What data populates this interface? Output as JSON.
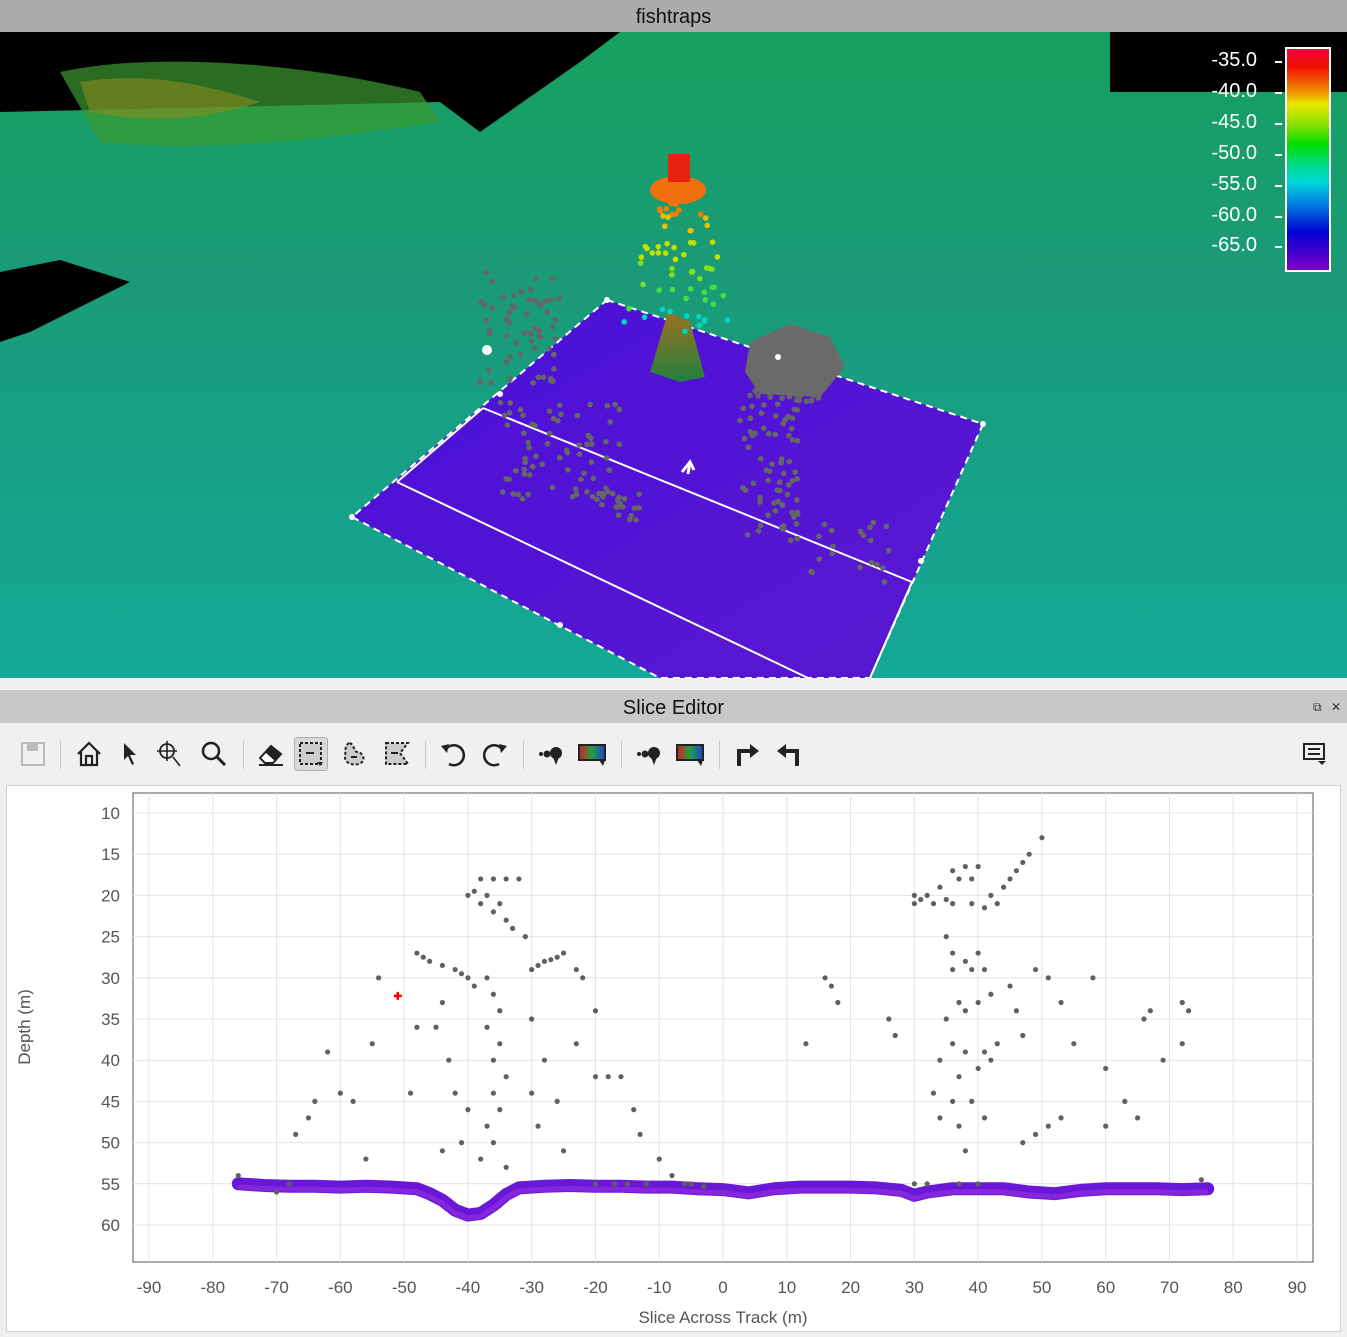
{
  "window_title": "fishtraps",
  "colorbar": {
    "labels": [
      "-35.0",
      "-40.0",
      "-45.0",
      "-50.0",
      "-55.0",
      "-60.0",
      "-65.0"
    ],
    "range": [
      -68,
      -33
    ]
  },
  "slice_editor": {
    "title": "Slice Editor",
    "float_icon": "⧉",
    "close_icon": "✕",
    "toolbar": [
      {
        "name": "save",
        "icon": "save-icon",
        "enabled": false
      },
      {
        "name": "home",
        "icon": "home-icon"
      },
      {
        "name": "select",
        "icon": "pointer-icon"
      },
      {
        "name": "pick",
        "icon": "crosshair-icon"
      },
      {
        "name": "zoom",
        "icon": "magnifier-icon"
      },
      {
        "name": "erase",
        "icon": "eraser-icon"
      },
      {
        "name": "rect-select",
        "icon": "rect-select-icon",
        "active": true
      },
      {
        "name": "lasso-select",
        "icon": "lasso-icon"
      },
      {
        "name": "poly-select",
        "icon": "poly-select-icon"
      },
      {
        "name": "undo",
        "icon": "undo-icon"
      },
      {
        "name": "redo",
        "icon": "redo-icon"
      },
      {
        "name": "point-style",
        "icon": "points-icon"
      },
      {
        "name": "color-map",
        "icon": "colormap-icon"
      },
      {
        "name": "point-style-2",
        "icon": "points-icon"
      },
      {
        "name": "color-map-2",
        "icon": "colormap-icon"
      },
      {
        "name": "next-slice",
        "icon": "turn-right-icon"
      },
      {
        "name": "prev-slice",
        "icon": "turn-left-icon"
      },
      {
        "name": "menu",
        "icon": "menu-icon"
      }
    ]
  },
  "chart_data": {
    "type": "scatter",
    "xlabel": "Slice Across Track (m)",
    "ylabel": "Depth (m)",
    "xlim": [
      -92.5,
      92.5
    ],
    "ylim": [
      7.6,
      64.6
    ],
    "y_inverted": true,
    "grid": true,
    "xticks": [
      "-90",
      "-80",
      "-70",
      "-60",
      "-50",
      "-40",
      "-30",
      "-20",
      "-10",
      "0",
      "10",
      "20",
      "30",
      "40",
      "50",
      "60",
      "70",
      "80",
      "90"
    ],
    "xtick_values": [
      -90,
      -80,
      -70,
      -60,
      -50,
      -40,
      -30,
      -20,
      -10,
      0,
      10,
      20,
      30,
      40,
      50,
      60,
      70,
      80,
      90
    ],
    "yticks": [
      "10",
      "15",
      "20",
      "25",
      "30",
      "35",
      "40",
      "45",
      "50",
      "55",
      "60"
    ],
    "ytick_values": [
      10,
      15,
      20,
      25,
      30,
      35,
      40,
      45,
      50,
      55,
      60
    ],
    "cursor_marker": {
      "x": -51,
      "y": 32.2,
      "color": "#ff0000"
    },
    "series": [
      {
        "name": "seafloor",
        "color": "#6a18d8",
        "points": [
          [
            -76,
            55
          ],
          [
            -72,
            55.2
          ],
          [
            -68,
            55.3
          ],
          [
            -64,
            55.3
          ],
          [
            -60,
            55.4
          ],
          [
            -56,
            55.3
          ],
          [
            -52,
            55.4
          ],
          [
            -48,
            55.6
          ],
          [
            -46,
            56.2
          ],
          [
            -44,
            57
          ],
          [
            -42,
            58.2
          ],
          [
            -40,
            58.8
          ],
          [
            -38,
            58.6
          ],
          [
            -36,
            57.6
          ],
          [
            -34,
            56.3
          ],
          [
            -32,
            55.5
          ],
          [
            -28,
            55.3
          ],
          [
            -24,
            55.2
          ],
          [
            -20,
            55.3
          ],
          [
            -16,
            55.3
          ],
          [
            -12,
            55.4
          ],
          [
            -8,
            55.4
          ],
          [
            -4,
            55.6
          ],
          [
            0,
            55.7
          ],
          [
            4,
            56.1
          ],
          [
            8,
            55.6
          ],
          [
            12,
            55.4
          ],
          [
            16,
            55.4
          ],
          [
            20,
            55.4
          ],
          [
            24,
            55.5
          ],
          [
            28,
            55.8
          ],
          [
            30,
            56.4
          ],
          [
            32,
            56
          ],
          [
            36,
            55.6
          ],
          [
            40,
            55.6
          ],
          [
            44,
            55.6
          ],
          [
            48,
            56
          ],
          [
            52,
            56.2
          ],
          [
            56,
            55.8
          ],
          [
            60,
            55.6
          ],
          [
            64,
            55.6
          ],
          [
            68,
            55.6
          ],
          [
            72,
            55.7
          ],
          [
            76,
            55.6
          ]
        ]
      },
      {
        "name": "rejected",
        "color": "#606060",
        "points": [
          [
            -38,
            18
          ],
          [
            -36,
            18
          ],
          [
            -34,
            18
          ],
          [
            -32,
            18
          ],
          [
            -40,
            20
          ],
          [
            -38,
            21
          ],
          [
            -36,
            22
          ],
          [
            -34,
            23
          ],
          [
            -33,
            24
          ],
          [
            -31,
            25
          ],
          [
            -39,
            19.5
          ],
          [
            -37,
            20
          ],
          [
            -35,
            21
          ],
          [
            -48,
            27
          ],
          [
            -47,
            27.5
          ],
          [
            -46,
            28
          ],
          [
            -44,
            28.5
          ],
          [
            -42,
            29
          ],
          [
            -41,
            29.5
          ],
          [
            -40,
            30
          ],
          [
            -39,
            31
          ],
          [
            -37,
            30
          ],
          [
            -30,
            29
          ],
          [
            -29,
            28.5
          ],
          [
            -28,
            28
          ],
          [
            -27,
            27.8
          ],
          [
            -26,
            27.5
          ],
          [
            -25,
            27
          ],
          [
            -36,
            32
          ],
          [
            -35,
            34
          ],
          [
            -37,
            36
          ],
          [
            -35,
            38
          ],
          [
            -36,
            40
          ],
          [
            -34,
            42
          ],
          [
            -36,
            44
          ],
          [
            -35,
            46
          ],
          [
            -37,
            48
          ],
          [
            -36,
            50
          ],
          [
            -38,
            52
          ],
          [
            -34,
            53
          ],
          [
            -44,
            33
          ],
          [
            -45,
            36
          ],
          [
            -43,
            40
          ],
          [
            -42,
            44
          ],
          [
            -40,
            46
          ],
          [
            -41,
            50
          ],
          [
            -44,
            51
          ],
          [
            -30,
            35
          ],
          [
            -28,
            40
          ],
          [
            -30,
            44
          ],
          [
            -29,
            48
          ],
          [
            -26,
            45
          ],
          [
            -25,
            51
          ],
          [
            -23,
            38
          ],
          [
            -22,
            30
          ],
          [
            -23,
            29
          ],
          [
            -54,
            30
          ],
          [
            -55,
            38
          ],
          [
            -56,
            52
          ],
          [
            -58,
            45
          ],
          [
            -60,
            44
          ],
          [
            -62,
            39
          ],
          [
            -64,
            45
          ],
          [
            -65,
            47
          ],
          [
            -67,
            49
          ],
          [
            -70,
            56
          ],
          [
            -49,
            44
          ],
          [
            -48,
            36
          ],
          [
            -20,
            34
          ],
          [
            -20,
            42
          ],
          [
            -18,
            42
          ],
          [
            -16,
            42
          ],
          [
            -14,
            46
          ],
          [
            -13,
            49
          ],
          [
            -10,
            52
          ],
          [
            -8,
            54
          ],
          [
            -6,
            55
          ],
          [
            -20,
            55
          ],
          [
            -17,
            55
          ],
          [
            -15,
            55
          ],
          [
            -12,
            55
          ],
          [
            -5,
            55
          ],
          [
            -3,
            55.3
          ],
          [
            -76,
            54
          ],
          [
            -68,
            55
          ],
          [
            30,
            20
          ],
          [
            32,
            20
          ],
          [
            34,
            19
          ],
          [
            36,
            17
          ],
          [
            38,
            16.5
          ],
          [
            40,
            16.5
          ],
          [
            42,
            20
          ],
          [
            44,
            19
          ],
          [
            46,
            17
          ],
          [
            48,
            15
          ],
          [
            50,
            13
          ],
          [
            30,
            21
          ],
          [
            33,
            21
          ],
          [
            36,
            21
          ],
          [
            39,
            21
          ],
          [
            41,
            21.5
          ],
          [
            43,
            21
          ],
          [
            31,
            20.5
          ],
          [
            35,
            20.5
          ],
          [
            37,
            18
          ],
          [
            39,
            18
          ],
          [
            45,
            18
          ],
          [
            47,
            16
          ],
          [
            35,
            25
          ],
          [
            36,
            27
          ],
          [
            38,
            28
          ],
          [
            40,
            27
          ],
          [
            36,
            29
          ],
          [
            39,
            29
          ],
          [
            41,
            29
          ],
          [
            37,
            33
          ],
          [
            35,
            35
          ],
          [
            38,
            34
          ],
          [
            40,
            33
          ],
          [
            42,
            32
          ],
          [
            36,
            38
          ],
          [
            38,
            39
          ],
          [
            41,
            39
          ],
          [
            43,
            38
          ],
          [
            34,
            40
          ],
          [
            37,
            42
          ],
          [
            40,
            41
          ],
          [
            42,
            40
          ],
          [
            33,
            44
          ],
          [
            36,
            45
          ],
          [
            39,
            45
          ],
          [
            34,
            47
          ],
          [
            37,
            48
          ],
          [
            41,
            47
          ],
          [
            38,
            51
          ],
          [
            45,
            31
          ],
          [
            46,
            34
          ],
          [
            47,
            37
          ],
          [
            49,
            29
          ],
          [
            51,
            30
          ],
          [
            53,
            33
          ],
          [
            55,
            38
          ],
          [
            53,
            47
          ],
          [
            51,
            48
          ],
          [
            49,
            49
          ],
          [
            47,
            50
          ],
          [
            58,
            30
          ],
          [
            60,
            41
          ],
          [
            60,
            48
          ],
          [
            63,
            45
          ],
          [
            65,
            47
          ],
          [
            66,
            35
          ],
          [
            67,
            34
          ],
          [
            69,
            40
          ],
          [
            72,
            33
          ],
          [
            73,
            34
          ],
          [
            72,
            38
          ],
          [
            16,
            30
          ],
          [
            17,
            31
          ],
          [
            18,
            33
          ],
          [
            13,
            38
          ],
          [
            26,
            35
          ],
          [
            27,
            37
          ],
          [
            30,
            55
          ],
          [
            32,
            55
          ],
          [
            37,
            55
          ],
          [
            40,
            55
          ],
          [
            75,
            54.5
          ]
        ]
      }
    ]
  }
}
